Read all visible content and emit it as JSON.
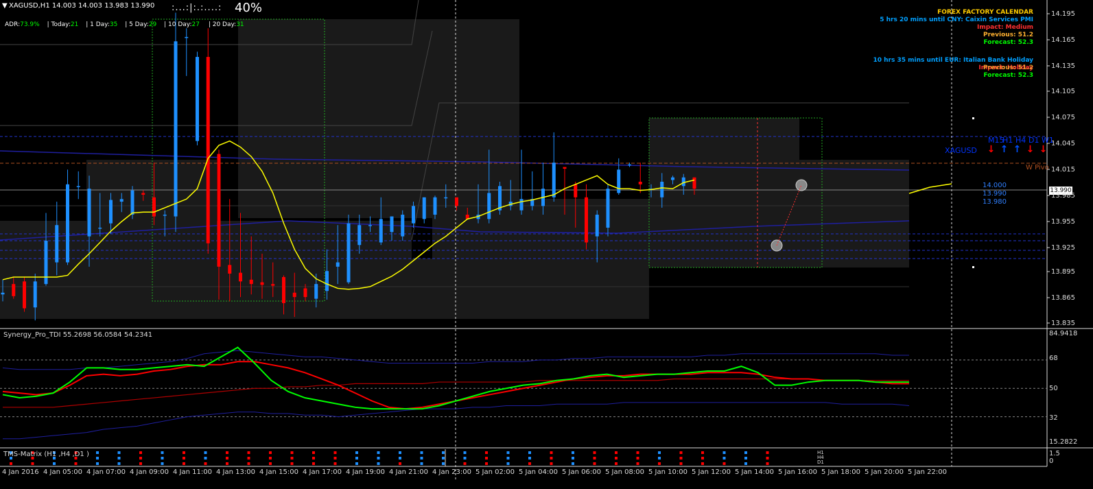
{
  "header": {
    "symbol_line": "XAGUSD,H1  14.003 14.003 13.983 13.990",
    "progress_bar": ":...:|:.:....:",
    "progress_text": "40%",
    "progress_fraction": 0.4
  },
  "adr": {
    "label": "ADR:",
    "value": "73.9%",
    "today_label": "| Today:",
    "today": "21",
    "d1_label": "| 1 Day:",
    "d1": "35",
    "d5_label": "| 5 Day:",
    "d5": "29",
    "d10_label": "| 10 Day:",
    "d10": "27",
    "d20_label": "| 20 Day:",
    "d20": "31"
  },
  "calendar": {
    "title": "FOREX FACTORY CALENDAR",
    "event1_time": "5 hrs 20 mins until CNY: Caixin Services PMI",
    "event1_impact": "Impact: Medium",
    "event1_previous": "Previous: 51.2",
    "event1_forecast": "Forecast: 52.3",
    "event2_time": "10 hrs 35 mins until EUR: Italian Bank Holiday",
    "event2_impact": "Impact: Holiday",
    "event2_previous": "Previous: 51.2",
    "event2_forecast": "Forecast: 52.3"
  },
  "matrix_widget": {
    "symbol": "XAGUSD",
    "timeframes": [
      "M15",
      "H1",
      "H4",
      "D1",
      "W1"
    ],
    "directions": [
      "down",
      "up",
      "up",
      "down",
      "down"
    ]
  },
  "pivot_label": "W Pivo",
  "price_levels_box": [
    "14.000",
    "13.990",
    "13.980"
  ],
  "current_price": "13.990",
  "price_axis": [
    "14.195",
    "14.165",
    "14.135",
    "14.105",
    "14.075",
    "14.045",
    "14.015",
    "13.985",
    "13.955",
    "13.925",
    "13.895",
    "13.865",
    "13.835"
  ],
  "time_axis": [
    "4 Jan 2016",
    "4 Jan 05:00",
    "4 Jan 07:00",
    "4 Jan 09:00",
    "4 Jan 11:00",
    "4 Jan 13:00",
    "4 Jan 15:00",
    "4 Jan 17:00",
    "4 Jan 19:00",
    "4 Jan 21:00",
    "4 Jan 23:00",
    "5 Jan 02:00",
    "5 Jan 04:00",
    "5 Jan 06:00",
    "5 Jan 08:00",
    "5 Jan 10:00",
    "5 Jan 12:00",
    "5 Jan 14:00",
    "5 Jan 16:00",
    "5 Jan 18:00",
    "5 Jan 20:00",
    "5 Jan 22:00"
  ],
  "tdi": {
    "title": "Synergy_Pro_TDI 55.2698 56.0584 54.2341",
    "axis": [
      "84.9418",
      "68",
      "50",
      "32",
      "15.2822"
    ]
  },
  "tms": {
    "title": "TMS-Matrix (H1 ,H4 ,D1 )",
    "axis": [
      "1.5",
      "0"
    ],
    "legend": [
      "H1",
      "H4",
      "D1"
    ]
  },
  "colors": {
    "bull": "#1e90ff",
    "bear": "#ff0000",
    "ma": "#ffff00",
    "tdi_green": "#00ff00",
    "tdi_red": "#ff0000",
    "band": "#1f1fa0",
    "calendar_title": "#ffcc00",
    "calendar_event": "#00a0ff",
    "calendar_impact": "#ff3030",
    "calendar_previous": "#ffb030",
    "calendar_forecast": "#00ff00"
  },
  "chart_data": {
    "type": "candlestick",
    "ylim": [
      13.83,
      14.205
    ],
    "candles": [
      {
        "o": 13.868,
        "h": 13.885,
        "l": 13.86,
        "c": 13.87
      },
      {
        "o": 13.88,
        "h": 13.888,
        "l": 13.863,
        "c": 13.866
      },
      {
        "o": 13.883,
        "h": 13.888,
        "l": 13.848,
        "c": 13.852
      },
      {
        "o": 13.853,
        "h": 13.892,
        "l": 13.838,
        "c": 13.883
      },
      {
        "o": 13.88,
        "h": 13.962,
        "l": 13.878,
        "c": 13.93
      },
      {
        "o": 13.905,
        "h": 13.975,
        "l": 13.89,
        "c": 13.948
      },
      {
        "o": 13.905,
        "h": 14.012,
        "l": 13.902,
        "c": 13.995
      },
      {
        "o": 13.993,
        "h": 14.01,
        "l": 13.978,
        "c": 13.993
      },
      {
        "o": 13.935,
        "h": 14.005,
        "l": 13.9,
        "c": 13.99
      },
      {
        "o": 13.945,
        "h": 13.985,
        "l": 13.935,
        "c": 13.945
      },
      {
        "o": 13.95,
        "h": 13.985,
        "l": 13.938,
        "c": 13.977
      },
      {
        "o": 13.975,
        "h": 13.985,
        "l": 13.963,
        "c": 13.978
      },
      {
        "o": 13.96,
        "h": 13.993,
        "l": 13.955,
        "c": 13.988
      },
      {
        "o": 13.985,
        "h": 13.988,
        "l": 13.976,
        "c": 13.983
      },
      {
        "o": 13.98,
        "h": 14.02,
        "l": 13.948,
        "c": 13.958
      },
      {
        "o": 13.96,
        "h": 13.965,
        "l": 13.935,
        "c": 13.96
      },
      {
        "o": 13.958,
        "h": 14.193,
        "l": 13.94,
        "c": 14.16
      },
      {
        "o": 14.165,
        "h": 14.175,
        "l": 14.12,
        "c": 14.165
      },
      {
        "o": 14.045,
        "h": 14.148,
        "l": 14.04,
        "c": 14.142
      },
      {
        "o": 14.142,
        "h": 14.175,
        "l": 13.915,
        "c": 13.927
      },
      {
        "o": 14.03,
        "h": 14.035,
        "l": 13.862,
        "c": 13.9
      },
      {
        "o": 13.902,
        "h": 13.978,
        "l": 13.86,
        "c": 13.892
      },
      {
        "o": 13.893,
        "h": 13.962,
        "l": 13.865,
        "c": 13.883
      },
      {
        "o": 13.885,
        "h": 13.935,
        "l": 13.868,
        "c": 13.88
      },
      {
        "o": 13.882,
        "h": 13.915,
        "l": 13.863,
        "c": 13.879
      },
      {
        "o": 13.88,
        "h": 13.905,
        "l": 13.865,
        "c": 13.878
      },
      {
        "o": 13.888,
        "h": 13.89,
        "l": 13.845,
        "c": 13.858
      },
      {
        "o": 13.87,
        "h": 13.893,
        "l": 13.842,
        "c": 13.865
      },
      {
        "o": 13.875,
        "h": 13.88,
        "l": 13.86,
        "c": 13.865
      },
      {
        "o": 13.863,
        "h": 13.892,
        "l": 13.853,
        "c": 13.88
      },
      {
        "o": 13.872,
        "h": 13.92,
        "l": 13.862,
        "c": 13.895
      },
      {
        "o": 13.9,
        "h": 13.948,
        "l": 13.88,
        "c": 13.905
      },
      {
        "o": 13.882,
        "h": 13.96,
        "l": 13.88,
        "c": 13.95
      },
      {
        "o": 13.925,
        "h": 13.96,
        "l": 13.915,
        "c": 13.948
      },
      {
        "o": 13.948,
        "h": 13.958,
        "l": 13.94,
        "c": 13.948
      },
      {
        "o": 13.928,
        "h": 13.98,
        "l": 13.925,
        "c": 13.955
      },
      {
        "o": 13.94,
        "h": 13.958,
        "l": 13.93,
        "c": 13.958
      },
      {
        "o": 13.935,
        "h": 13.965,
        "l": 13.93,
        "c": 13.96
      },
      {
        "o": 13.95,
        "h": 13.975,
        "l": 13.945,
        "c": 13.97
      },
      {
        "o": 13.955,
        "h": 13.98,
        "l": 13.95,
        "c": 13.98
      },
      {
        "o": 13.96,
        "h": 13.982,
        "l": 13.955,
        "c": 13.98
      },
      {
        "o": 13.98,
        "h": 13.995,
        "l": 13.968,
        "c": 13.98
      },
      {
        "o": 13.98,
        "h": 13.978,
        "l": 13.965,
        "c": 13.97
      },
      {
        "o": 13.96,
        "h": 13.968,
        "l": 13.955,
        "c": 13.955
      },
      {
        "o": 13.955,
        "h": 13.995,
        "l": 13.95,
        "c": 13.96
      },
      {
        "o": 13.955,
        "h": 14.035,
        "l": 13.95,
        "c": 13.985
      },
      {
        "o": 13.965,
        "h": 13.998,
        "l": 13.96,
        "c": 13.993
      },
      {
        "o": 13.97,
        "h": 14.0,
        "l": 13.965,
        "c": 13.975
      },
      {
        "o": 13.965,
        "h": 14.035,
        "l": 13.96,
        "c": 13.978
      },
      {
        "o": 13.97,
        "h": 14.01,
        "l": 13.965,
        "c": 13.978
      },
      {
        "o": 13.97,
        "h": 14.02,
        "l": 13.96,
        "c": 13.99
      },
      {
        "o": 13.98,
        "h": 14.055,
        "l": 13.975,
        "c": 14.02
      },
      {
        "o": 14.015,
        "h": 14.015,
        "l": 13.96,
        "c": 14.013
      },
      {
        "o": 13.995,
        "h": 13.998,
        "l": 13.945,
        "c": 13.98
      },
      {
        "o": 13.98,
        "h": 13.995,
        "l": 13.92,
        "c": 13.928
      },
      {
        "o": 13.935,
        "h": 13.965,
        "l": 13.905,
        "c": 13.96
      },
      {
        "o": 13.945,
        "h": 13.995,
        "l": 13.935,
        "c": 13.99
      },
      {
        "o": 13.985,
        "h": 14.025,
        "l": 13.983,
        "c": 14.012
      },
      {
        "o": 14.018,
        "h": 14.02,
        "l": 14.015,
        "c": 14.018
      },
      {
        "o": 13.998,
        "h": 14.02,
        "l": 13.985,
        "c": 13.995
      },
      {
        "o": 13.99,
        "h": 13.995,
        "l": 13.98,
        "c": 13.99
      },
      {
        "o": 13.98,
        "h": 14.008,
        "l": 13.968,
        "c": 13.998
      },
      {
        "o": 14.0,
        "h": 14.005,
        "l": 13.995,
        "c": 14.003
      },
      {
        "o": 13.993,
        "h": 14.007,
        "l": 13.983,
        "c": 14.003
      },
      {
        "o": 14.003,
        "h": 14.003,
        "l": 13.983,
        "c": 13.99
      }
    ],
    "ma": [
      13.885,
      13.888,
      13.888,
      13.888,
      13.888,
      13.888,
      13.89,
      13.903,
      13.915,
      13.928,
      13.941,
      13.952,
      13.962,
      13.963,
      13.963,
      13.968,
      13.973,
      13.978,
      13.99,
      14.025,
      14.04,
      14.045,
      14.038,
      14.027,
      14.01,
      13.985,
      13.95,
      13.92,
      13.898,
      13.886,
      13.88,
      13.875,
      13.874,
      13.875,
      13.877,
      13.883,
      13.889,
      13.897,
      13.907,
      13.917,
      13.927,
      13.935,
      13.945,
      13.955,
      13.958,
      13.963,
      13.968,
      13.972,
      13.975,
      13.977,
      13.98,
      13.983,
      13.99,
      13.995,
      14.0,
      14.005,
      13.995,
      13.99,
      13.99,
      13.988,
      13.989,
      13.991,
      13.99,
      13.997,
      14.0
    ],
    "tdi": {
      "ylim": [
        15.2822,
        84.9418
      ],
      "green": [
        46,
        44,
        45,
        47,
        54,
        63,
        63,
        62,
        62,
        63,
        64,
        65,
        64,
        70,
        76,
        66,
        55,
        48,
        44,
        42,
        40,
        38,
        37,
        37,
        37,
        37,
        39,
        42,
        45,
        48,
        50,
        52,
        53,
        55,
        56,
        58,
        59,
        57,
        58,
        59,
        59,
        60,
        61,
        61,
        64,
        60,
        52,
        52,
        54,
        55,
        55,
        55,
        54,
        54,
        54
      ],
      "red": [
        48,
        47,
        46,
        47,
        52,
        58,
        59,
        58,
        59,
        61,
        62,
        64,
        65,
        65,
        67,
        67,
        65,
        63,
        60,
        56,
        52,
        47,
        42,
        38,
        37,
        38,
        40,
        42,
        44,
        46,
        48,
        50,
        52,
        54,
        56,
        57,
        58,
        58,
        59,
        59,
        59,
        59,
        60,
        60,
        60,
        59,
        57,
        56,
        56,
        55,
        55,
        55,
        54,
        53,
        53
      ],
      "base": [
        38,
        38,
        38,
        38,
        39,
        40,
        41,
        42,
        43,
        44,
        45,
        46,
        47,
        48,
        49,
        50,
        50,
        51,
        51,
        52,
        52,
        53,
        53,
        53,
        53,
        53,
        54,
        54,
        54,
        54,
        54,
        54,
        55,
        55,
        55,
        55,
        55,
        55,
        55,
        55,
        56,
        56,
        56,
        56,
        56,
        56,
        56,
        56,
        56,
        55,
        55,
        55,
        55,
        55,
        55
      ],
      "upper": [
        63,
        62,
        62,
        62,
        62,
        63,
        63,
        64,
        65,
        66,
        67,
        69,
        72,
        73,
        74,
        73,
        72,
        71,
        70,
        70,
        69,
        68,
        67,
        66,
        66,
        66,
        66,
        66,
        66,
        67,
        67,
        67,
        68,
        68,
        69,
        69,
        70,
        70,
        70,
        70,
        70,
        70,
        71,
        71,
        72,
        72,
        72,
        72,
        72,
        72,
        72,
        72,
        72,
        71,
        71
      ],
      "lower": [
        18,
        18,
        19,
        20,
        21,
        22,
        24,
        25,
        26,
        28,
        30,
        32,
        33,
        34,
        35,
        35,
        34,
        34,
        33,
        33,
        32,
        33,
        34,
        35,
        36,
        37,
        37,
        37,
        38,
        38,
        39,
        39,
        39,
        40,
        40,
        40,
        40,
        41,
        41,
        41,
        41,
        41,
        41,
        41,
        41,
        41,
        41,
        41,
        41,
        41,
        40,
        40,
        40,
        40,
        39
      ]
    }
  }
}
